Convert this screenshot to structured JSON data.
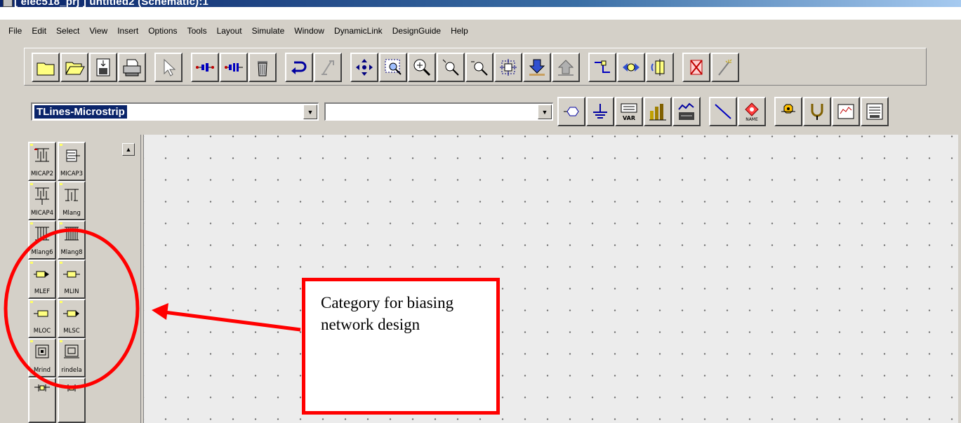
{
  "window": {
    "title": "[ elec518_prj ] untitled2 (Schematic):1"
  },
  "menu": [
    "File",
    "Edit",
    "Select",
    "View",
    "Insert",
    "Options",
    "Tools",
    "Layout",
    "Simulate",
    "Window",
    "DynamicLink",
    "DesignGuide",
    "Help"
  ],
  "toolbar_icons": [
    "new-schematic-icon",
    "open-file-icon",
    "save-icon",
    "print-icon",
    "select-pointer-icon",
    "insert-port-icon",
    "insert-ground-port-icon",
    "delete-icon",
    "undo-icon",
    "redo-icon",
    "pan-icon",
    "zoom-area-icon",
    "zoom-in-icon",
    "zoom-point-icon",
    "zoom-out-icon",
    "view-all-icon",
    "push-into-icon",
    "pop-out-icon",
    "wire-icon",
    "mirror-icon",
    "rotate-icon",
    "deactivate-icon",
    "tune-icon"
  ],
  "toolbar2": {
    "library_value": "TLines-Microstrip",
    "component_value": "",
    "icons": [
      "port-icon",
      "ground-icon",
      "var-equation-icon",
      "simulate-icon",
      "display-data-icon",
      "insert-wire-icon",
      "wire-label-icon",
      "component-history-icon",
      "probe-icon",
      "display-template-icon",
      "data-file-icon"
    ],
    "var_label": "VAR",
    "name_label": "NAME"
  },
  "palette": {
    "items": [
      {
        "label": "MICAP2"
      },
      {
        "label": "MICAP3"
      },
      {
        "label": "MICAP4"
      },
      {
        "label": "Mlang"
      },
      {
        "label": "Mlang6"
      },
      {
        "label": "Mlang8"
      },
      {
        "label": "MLEF"
      },
      {
        "label": "MLIN"
      },
      {
        "label": "MLOC"
      },
      {
        "label": "MLSC"
      },
      {
        "label": "Mrind"
      },
      {
        "label": "rindela"
      }
    ]
  },
  "annotation": {
    "text": "Category for biasing network design",
    "color": "#ff0000"
  },
  "colors": {
    "face": "#d4d0c8",
    "titlebar": "#0a246a",
    "selection": "#0a246a",
    "canvas": "#ececec",
    "annotation": "#ff0000"
  }
}
